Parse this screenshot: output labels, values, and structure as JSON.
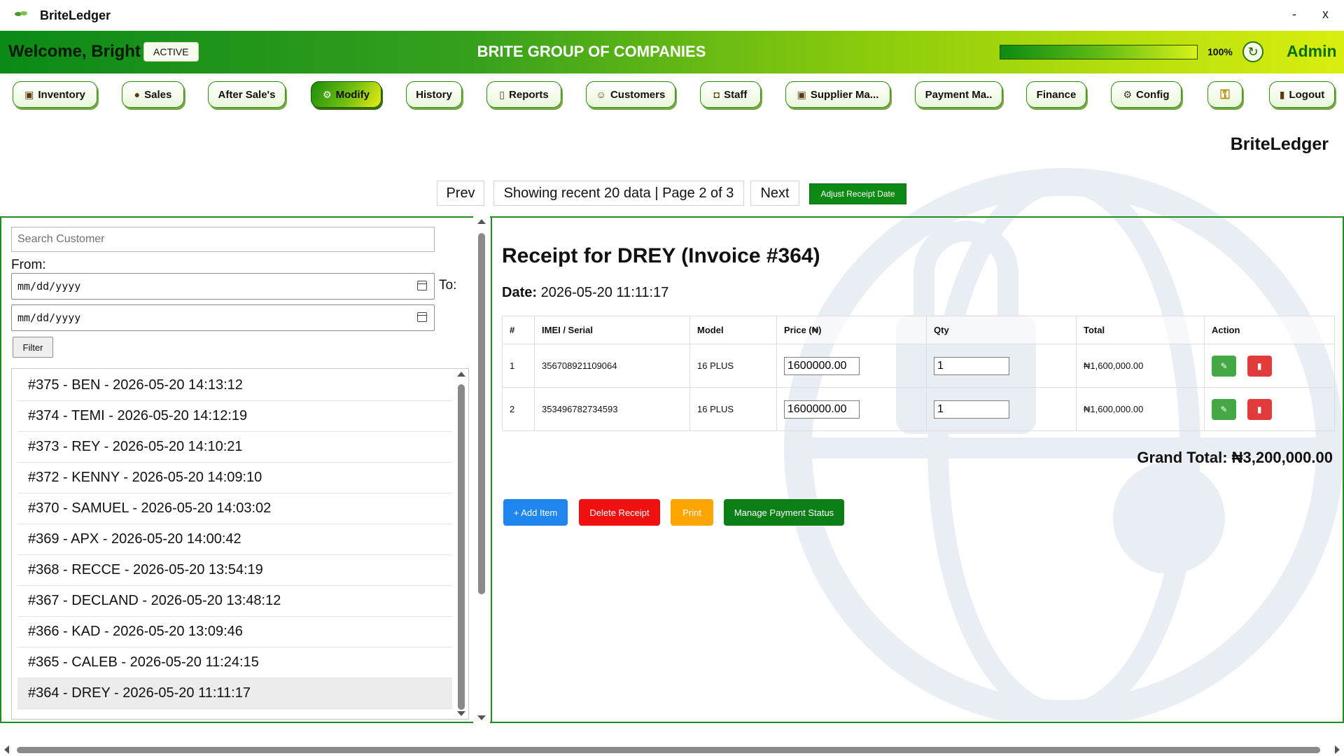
{
  "window": {
    "title": "BriteLedger",
    "logo_icon": "money-leaf-icon",
    "minimize_label": "-",
    "close_label": "x"
  },
  "header": {
    "welcome": "Welcome, Bright",
    "status_badge": "ACTIVE",
    "company": "BRITE GROUP OF COMPANIES",
    "progress_percent": 100,
    "progress_label": "100%",
    "refresh_icon": "refresh-icon",
    "role": "Admin"
  },
  "nav": {
    "items": [
      {
        "label": "Inventory",
        "icon": "box-icon"
      },
      {
        "label": "Sales",
        "icon": "money-bag-icon"
      },
      {
        "label": "After Sale's",
        "icon": ""
      },
      {
        "label": "Modify",
        "icon": "gear-icon"
      },
      {
        "label": "History",
        "icon": ""
      },
      {
        "label": "Reports",
        "icon": "document-icon"
      },
      {
        "label": "Customers",
        "icon": "person-icon"
      },
      {
        "label": "Staff",
        "icon": "staff-icon"
      },
      {
        "label": "Supplier Ma...",
        "icon": "box-icon"
      },
      {
        "label": "Payment Ma..",
        "icon": ""
      },
      {
        "label": "Finance",
        "icon": ""
      },
      {
        "label": "Config",
        "icon": "gear-icon"
      },
      {
        "label": "",
        "icon": "key-icon"
      },
      {
        "label": "Logout",
        "icon": "door-icon"
      }
    ],
    "active": "Modify"
  },
  "brand": "BriteLedger",
  "pagination": {
    "prev_label": "Prev",
    "info": "Showing recent 20 data | Page 2 of 3",
    "next_label": "Next",
    "adjust_label": "Adjust Receipt Date"
  },
  "filter": {
    "search_placeholder": "Search Customer",
    "from_label": "From:",
    "to_label": "To:",
    "date_placeholder": "mm/dd/yyyy",
    "filter_label": "Filter"
  },
  "receipts": [
    "#375 - BEN - 2026-05-20 14:13:12",
    "#374 - TEMI - 2026-05-20 14:12:19",
    "#373 - REY - 2026-05-20 14:10:21",
    "#372 - KENNY - 2026-05-20 14:09:10",
    "#370 - SAMUEL - 2026-05-20 14:03:02",
    "#369 - APX - 2026-05-20 14:00:42",
    "#368 - RECCE - 2026-05-20 13:54:19",
    "#367 - DECLAND - 2026-05-20 13:48:12",
    "#366 - KAD - 2026-05-20 13:09:46",
    "#365 - CALEB - 2026-05-20 11:24:15",
    "#364 - DREY - 2026-05-20 11:11:17"
  ],
  "selected_receipt": "#364 - DREY - 2026-05-20 11:11:17",
  "receipt": {
    "title": "Receipt for DREY (Invoice #364)",
    "date_label": "Date:",
    "date_value": "2026-05-20 11:11:17",
    "columns": [
      "#",
      "IMEI / Serial",
      "Model",
      "Price (₦)",
      "Qty",
      "Total",
      "Action"
    ],
    "rows": [
      {
        "num": "1",
        "imei": "356708921109064",
        "model": "16 PLUS",
        "price": "1600000.00",
        "qty": "1",
        "total": "₦1,600,000.00"
      },
      {
        "num": "2",
        "imei": "353496782734593",
        "model": "16 PLUS",
        "price": "1600000.00",
        "qty": "1",
        "total": "₦1,600,000.00"
      }
    ],
    "edit_icon": "pencil-icon",
    "delete_icon": "trash-icon",
    "grand_total": "Grand Total: ₦3,200,000.00",
    "add_item_label": "+ Add Item",
    "delete_receipt_label": "Delete Receipt",
    "print_label": "Print",
    "manage_payment_label": "Manage Payment Status"
  },
  "colors": {
    "brand_green": "#0c8a14",
    "accent_yellow": "#d9ee0e",
    "add_blue": "#1f86f0",
    "delete_red": "#f01010",
    "print_orange": "#ffa500",
    "manage_green": "#0b7e16"
  }
}
